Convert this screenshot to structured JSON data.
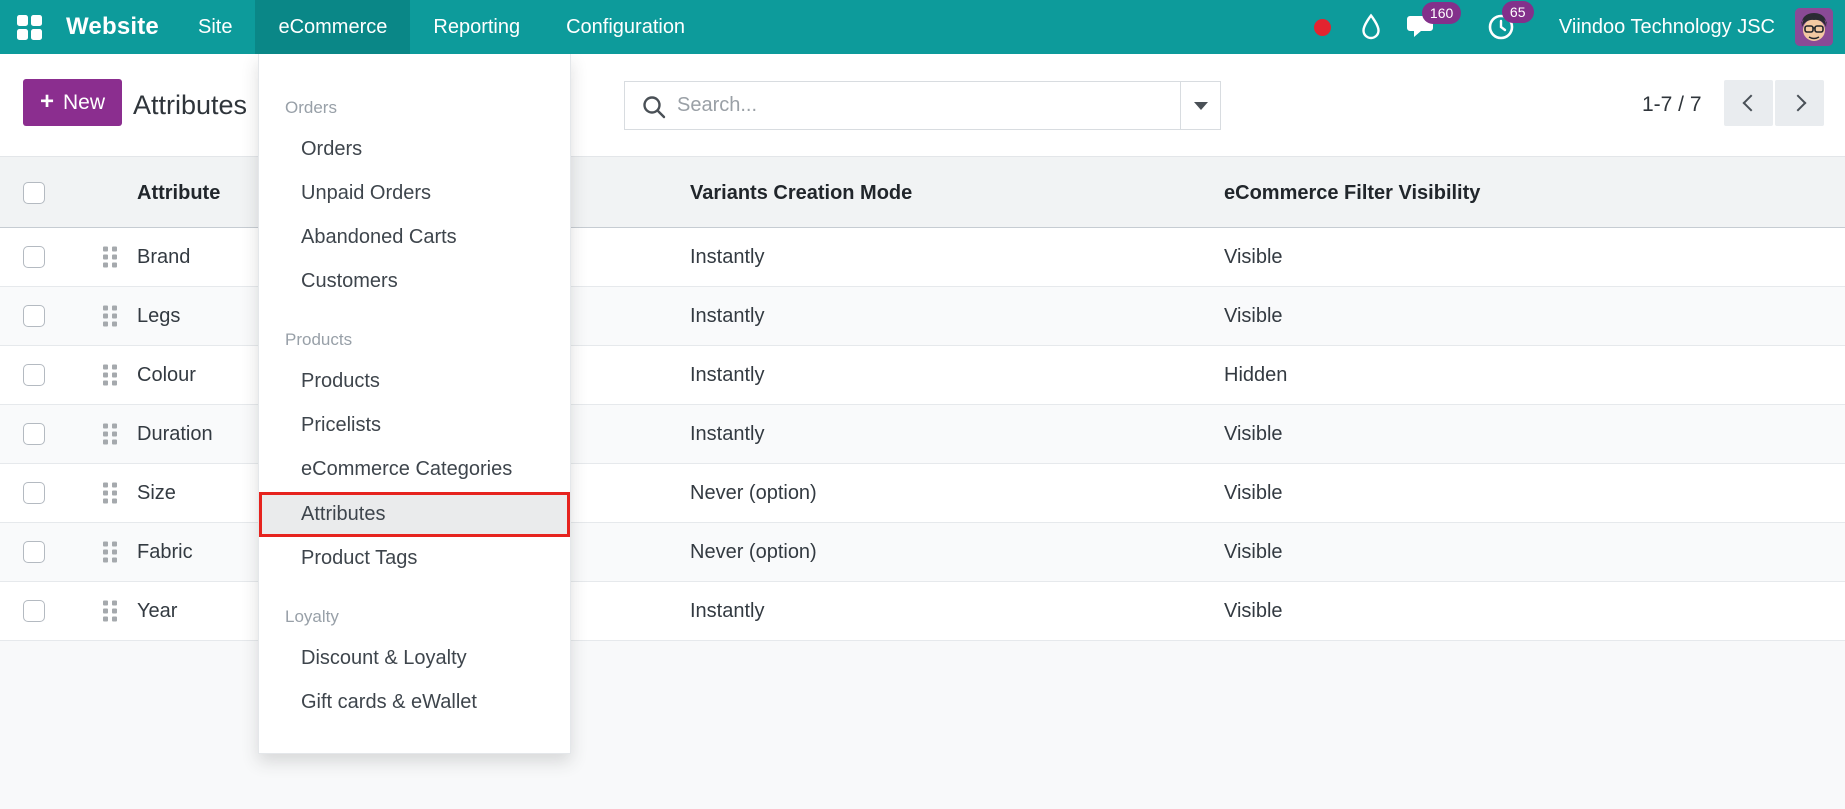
{
  "navbar": {
    "app_name": "Website",
    "menus": [
      {
        "label": "Site",
        "active": false
      },
      {
        "label": "eCommerce",
        "active": true
      },
      {
        "label": "Reporting",
        "active": false
      },
      {
        "label": "Configuration",
        "active": false
      }
    ],
    "messages_badge": "160",
    "activities_badge": "65",
    "company": "Viindoo Technology JSC"
  },
  "control_panel": {
    "new_button_label": "New",
    "title": "Attributes",
    "search_placeholder": "Search...",
    "pager_text": "1-7 / 7"
  },
  "dropdown_menu": {
    "sections": [
      {
        "title": "Orders",
        "items": [
          {
            "label": "Orders",
            "highlighted": false
          },
          {
            "label": "Unpaid Orders",
            "highlighted": false
          },
          {
            "label": "Abandoned Carts",
            "highlighted": false
          },
          {
            "label": "Customers",
            "highlighted": false
          }
        ]
      },
      {
        "title": "Products",
        "items": [
          {
            "label": "Products",
            "highlighted": false
          },
          {
            "label": "Pricelists",
            "highlighted": false
          },
          {
            "label": "eCommerce Categories",
            "highlighted": false
          },
          {
            "label": "Attributes",
            "highlighted": true
          },
          {
            "label": "Product Tags",
            "highlighted": false
          }
        ]
      },
      {
        "title": "Loyalty",
        "items": [
          {
            "label": "Discount & Loyalty",
            "highlighted": false
          },
          {
            "label": "Gift cards & eWallet",
            "highlighted": false
          }
        ]
      }
    ]
  },
  "table": {
    "columns": {
      "attribute": "Attribute",
      "variants_creation_mode": "Variants Creation Mode",
      "ecommerce_filter_visibility": "eCommerce Filter Visibility"
    },
    "rows": [
      {
        "attribute": "Brand",
        "variants_creation_mode": "Instantly",
        "ecommerce_filter_visibility": "Visible"
      },
      {
        "attribute": "Legs",
        "variants_creation_mode": "Instantly",
        "ecommerce_filter_visibility": "Visible"
      },
      {
        "attribute": "Colour",
        "variants_creation_mode": "Instantly",
        "ecommerce_filter_visibility": "Hidden"
      },
      {
        "attribute": "Duration",
        "variants_creation_mode": "Instantly",
        "ecommerce_filter_visibility": "Visible"
      },
      {
        "attribute": "Size",
        "variants_creation_mode": "Never (option)",
        "ecommerce_filter_visibility": "Visible"
      },
      {
        "attribute": "Fabric",
        "variants_creation_mode": "Never (option)",
        "ecommerce_filter_visibility": "Visible"
      },
      {
        "attribute": "Year",
        "variants_creation_mode": "Instantly",
        "ecommerce_filter_visibility": "Visible"
      }
    ]
  },
  "icons": {
    "apps_menu": "grid",
    "record_indicator": "red-dot",
    "drop": "droplet",
    "messages": "chat-bubble",
    "activities": "clock",
    "search": "magnifier",
    "dropdown_toggle": "caret-down",
    "pager_prev": "chevron-left",
    "pager_next": "chevron-right",
    "row_drag": "grip-dots"
  },
  "colors": {
    "navbar_bg": "#0d9b9b",
    "navbar_active_bg": "#0a8787",
    "primary_button": "#8b2e8f",
    "badge": "#83308b",
    "record_dot": "#e3242f",
    "highlight_border": "#e6231e"
  }
}
